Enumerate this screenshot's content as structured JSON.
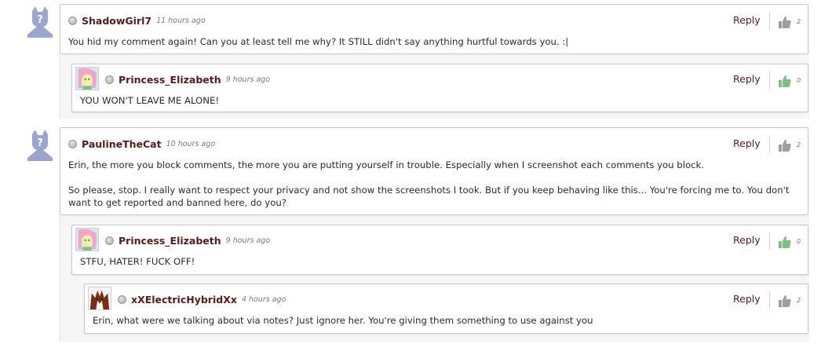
{
  "comments": [
    {
      "user": "ShadowGirl7",
      "time": "11 hours ago",
      "text": "You hid my comment again! Can you at least tell me why? It STILL didn't say anything hurtful towards you. :|",
      "reply_label": "Reply",
      "likes": "2",
      "thumb_color": "#9e9e9e",
      "avatar": "default-avatar-icon"
    },
    {
      "user": "Princess_Elizabeth",
      "time": "9 hours ago",
      "text": "YOU WON'T LEAVE ME ALONE!",
      "reply_label": "Reply",
      "likes": "0",
      "thumb_color": "#7dc07d",
      "avatar": "pony-avatar-icon"
    },
    {
      "user": "PaulineTheCat",
      "time": "10 hours ago",
      "text_p1": "Erin, the more you block comments, the more you are putting yourself in trouble. Especially when I screenshot each comments you block.",
      "text_p2": "So please, stop. I really want to respect your privacy and not show the screenshots I took. But if you keep behaving like this... You're forcing me to. You don't want to get reported and banned here, do you?",
      "reply_label": "Reply",
      "likes": "2",
      "thumb_color": "#9e9e9e",
      "avatar": "default-avatar-icon"
    },
    {
      "user": "Princess_Elizabeth",
      "time": "9 hours ago",
      "text": "STFU, HATER! FUCK OFF!",
      "reply_label": "Reply",
      "likes": "0",
      "thumb_color": "#7dc07d",
      "avatar": "pony-avatar-icon"
    },
    {
      "user": "xXElectricHybridXx",
      "time": "4 hours ago",
      "text": "Erin, what were we talking about via notes? Just ignore her. You're giving them something to use against you",
      "reply_label": "Reply",
      "likes": "2",
      "thumb_color": "#9e9e9e",
      "avatar": "wolf-avatar-icon"
    }
  ]
}
